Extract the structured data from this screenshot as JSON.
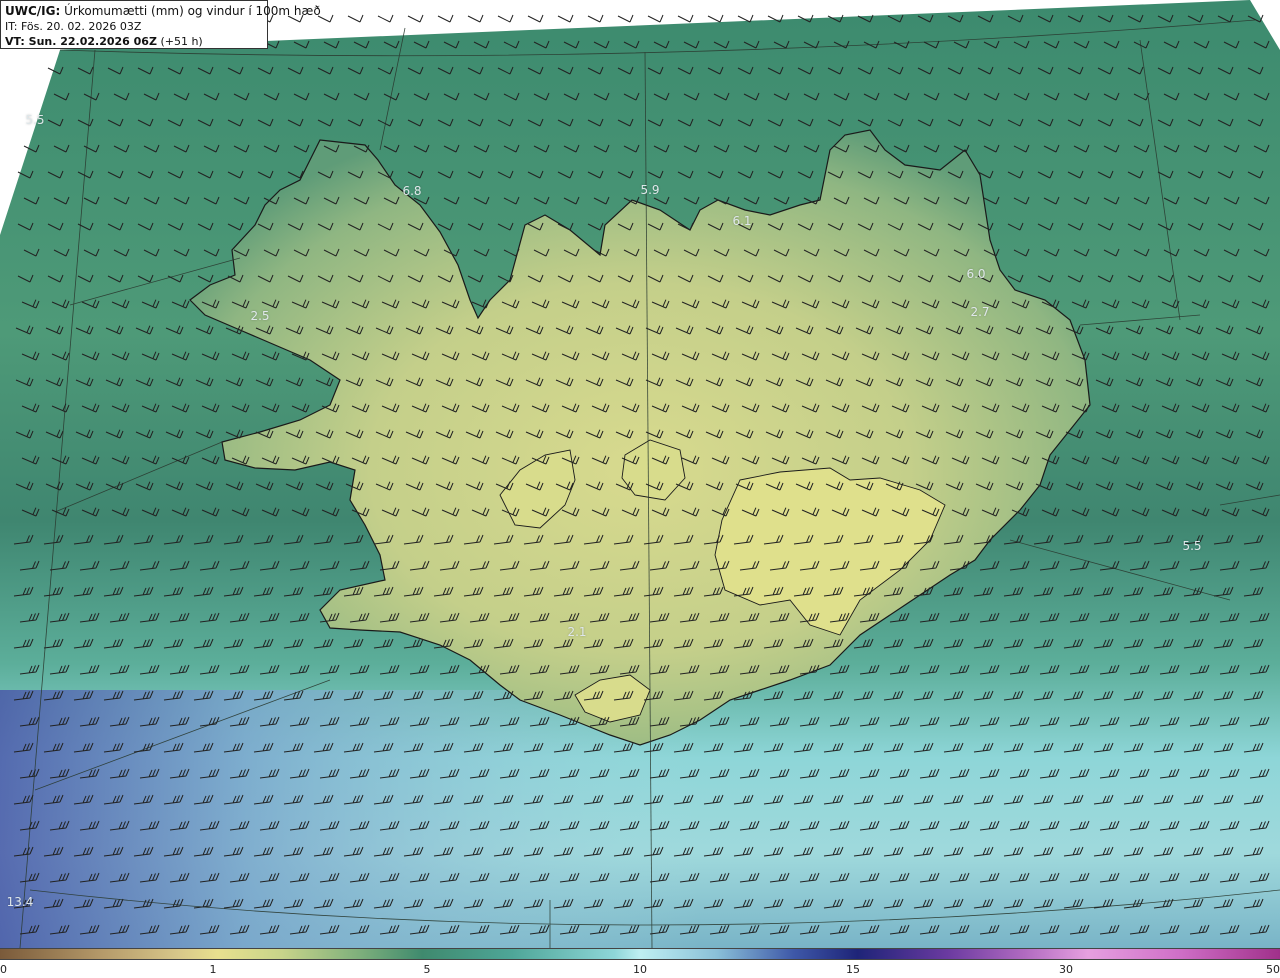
{
  "title": {
    "product": "UWC/IG:",
    "description": "Úrkomumætti (mm) og vindur í 100m hæð",
    "init_label": "IT: Fös. 20. 02. 2026 03Z",
    "valid_prefix": "VT: Sun. 22.02.2026 06Z",
    "valid_suffix": "(+51 h)"
  },
  "colors": {
    "ocean_south": "#8ed6d8",
    "ocean_deep_south": "#4a58a8",
    "ocean_north": "#3f8a70",
    "land_high": "#d6d88c",
    "land_low": "#9cba86",
    "coast_line": "#1a1a1a",
    "wind_barb": "#222222"
  },
  "colorbar": {
    "ticks": [
      "0",
      "1",
      "5",
      "10",
      "15",
      "30",
      "50"
    ]
  },
  "value_labels": [
    {
      "text": "5.5",
      "name": "label-nw-ocean"
    },
    {
      "text": "6.8",
      "name": "label-westfjords-north"
    },
    {
      "text": "5.9",
      "name": "label-north-coast"
    },
    {
      "text": "6.1",
      "name": "label-northeast-bay"
    },
    {
      "text": "6.0",
      "name": "label-east-coast"
    },
    {
      "text": "2.7",
      "name": "label-east-land"
    },
    {
      "text": "2.5",
      "name": "label-westfjords-south"
    },
    {
      "text": "2.1",
      "name": "label-south-land"
    },
    {
      "text": "5.5",
      "name": "label-east-ocean"
    },
    {
      "text": "13.4",
      "name": "label-sw-ocean"
    }
  ]
}
